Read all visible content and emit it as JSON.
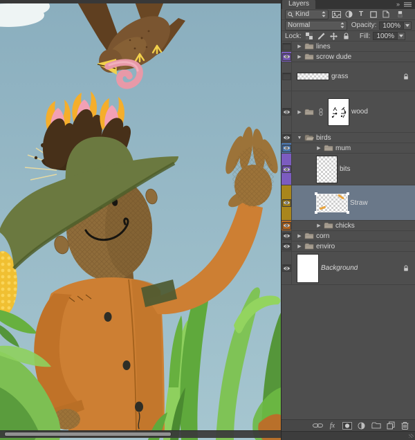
{
  "canvas": {
    "scene": "scarecrow-illustration",
    "colors": {
      "sky": "#8FB2C1",
      "coat": "#CC7F33",
      "hat": "#6B7940",
      "hat_band": "#D98F2F",
      "bird": "#77512C",
      "worm": "#E899A8",
      "corn": "#F0C032",
      "grass": "#5FA93C",
      "head": "#8F6C3A",
      "chick": "#473019"
    },
    "scrollbar": {
      "thumb_ratio": 0.6
    }
  },
  "layers_panel": {
    "title": "Layers",
    "collapse_glyph": "»",
    "filter": {
      "kind": "Kind",
      "icons": [
        "filter-pixel-icon",
        "filter-adjustment-icon",
        "filter-type-icon",
        "filter-shape-icon",
        "filter-smart-icon",
        "filter-switch-icon"
      ]
    },
    "blend": {
      "mode": "Normal",
      "opacity_label": "Opacity:",
      "opacity": "100%"
    },
    "lock": {
      "label": "Lock:",
      "icons": [
        "lock-transparency-icon",
        "lock-paint-icon",
        "lock-move-icon",
        "lock-all-icon"
      ],
      "fill_label": "Fill:",
      "fill": "100%"
    },
    "fx_label": "fx",
    "selected_row_color": "#6A7889",
    "label_colors": {
      "violet": "#7C5CC0",
      "blue": "#4E7FBE",
      "yellow": "#A9861C",
      "orange": "#BF6B1F"
    },
    "layers": [
      {
        "name": "lines",
        "kind": "group",
        "visible": false,
        "indent": 0
      },
      {
        "name": "scrow dude",
        "kind": "group",
        "visible": true,
        "indent": 0,
        "label_color": "#7C5CC0"
      },
      {
        "name": "grass",
        "kind": "layer",
        "visible": false,
        "indent": 0,
        "thumb": "checker-wide",
        "locked": true
      },
      {
        "name": "wood",
        "kind": "group",
        "visible": true,
        "indent": 0,
        "mask_link": true,
        "thumb": "mask"
      },
      {
        "name": "birds",
        "kind": "group",
        "visible": true,
        "indent": 0,
        "expanded": true
      },
      {
        "name": "mum",
        "kind": "group",
        "visible": true,
        "indent": 1,
        "label_color": "#4E7FBE"
      },
      {
        "name": "bits",
        "kind": "layer",
        "visible": true,
        "indent": 1,
        "label_color": "#7C5CC0",
        "thumb": "checker-tall"
      },
      {
        "name": "Straw",
        "kind": "layer",
        "visible": true,
        "indent": 1,
        "label_color": "#A9861C",
        "thumb": "checker-sel",
        "selected": true
      },
      {
        "name": "chicks",
        "kind": "group",
        "visible": true,
        "indent": 1,
        "label_color": "#BF6B1F"
      },
      {
        "name": "corn",
        "kind": "group",
        "visible": true,
        "indent": 0
      },
      {
        "name": "enviro",
        "kind": "group",
        "visible": true,
        "indent": 0
      },
      {
        "name": "Background",
        "kind": "background",
        "visible": true,
        "indent": 0,
        "thumb": "white",
        "locked": true,
        "italic": true
      }
    ],
    "bottom_icons": [
      "link-layers-icon",
      "layer-style-fx-icon",
      "add-mask-icon",
      "adjustment-layer-icon",
      "new-group-icon",
      "new-layer-icon",
      "delete-layer-icon"
    ]
  }
}
